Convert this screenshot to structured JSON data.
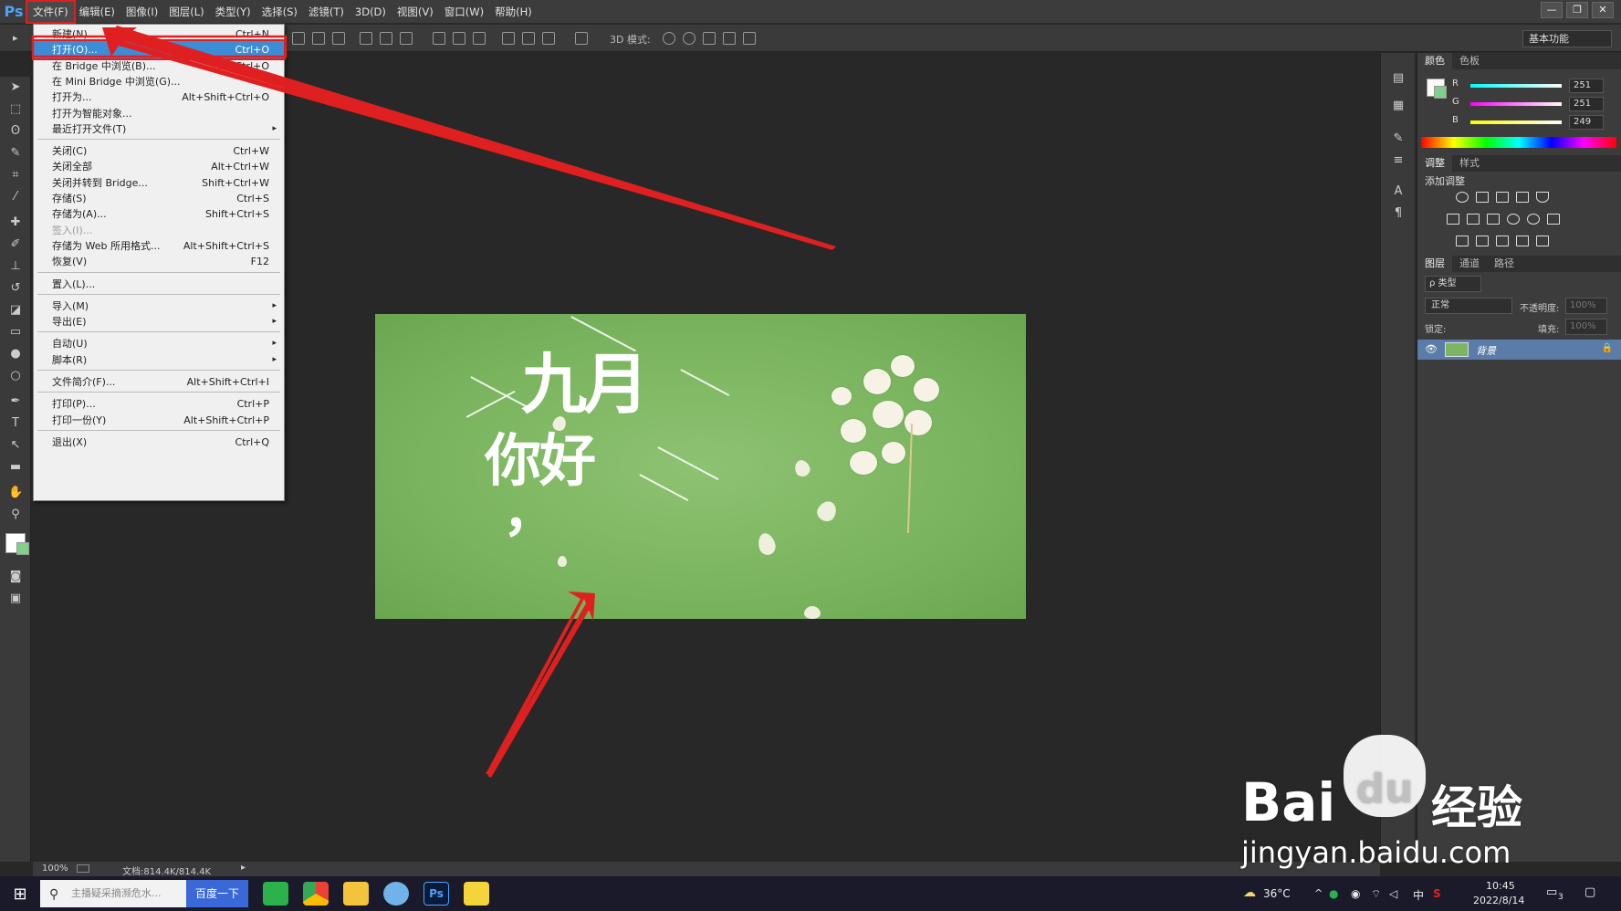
{
  "app": {
    "logo": "Ps"
  },
  "menubar": {
    "items": [
      "文件(F)",
      "编辑(E)",
      "图像(I)",
      "图层(L)",
      "类型(Y)",
      "选择(S)",
      "滤镜(T)",
      "3D(D)",
      "视图(V)",
      "窗口(W)",
      "帮助(H)"
    ]
  },
  "window_controls": {
    "minimize": "—",
    "restore": "❐",
    "close": "✕"
  },
  "optionsbar": {
    "mode3d_label": "3D 模式:",
    "workspace": "基本功能"
  },
  "file_menu": {
    "items": [
      {
        "label": "新建(N)...",
        "shortcut": "Ctrl+N"
      },
      {
        "label": "打开(O)...",
        "shortcut": "Ctrl+O",
        "highlighted": true
      },
      {
        "label": "在 Bridge 中浏览(B)...",
        "shortcut": "Alt+Ctrl+O"
      },
      {
        "label": "在 Mini Bridge 中浏览(G)...",
        "shortcut": ""
      },
      {
        "label": "打开为...",
        "shortcut": "Alt+Shift+Ctrl+O"
      },
      {
        "label": "打开为智能对象...",
        "shortcut": ""
      },
      {
        "label": "最近打开文件(T)",
        "shortcut": "",
        "submenu": true
      },
      {
        "label": "关闭(C)",
        "shortcut": "Ctrl+W"
      },
      {
        "label": "关闭全部",
        "shortcut": "Alt+Ctrl+W"
      },
      {
        "label": "关闭并转到 Bridge...",
        "shortcut": "Shift+Ctrl+W"
      },
      {
        "label": "存储(S)",
        "shortcut": "Ctrl+S"
      },
      {
        "label": "存储为(A)...",
        "shortcut": "Shift+Ctrl+S"
      },
      {
        "label": "签入(I)...",
        "shortcut": "",
        "disabled": true
      },
      {
        "label": "存储为 Web 所用格式...",
        "shortcut": "Alt+Shift+Ctrl+S"
      },
      {
        "label": "恢复(V)",
        "shortcut": "F12"
      },
      {
        "label": "置入(L)...",
        "shortcut": ""
      },
      {
        "label": "导入(M)",
        "shortcut": "",
        "submenu": true
      },
      {
        "label": "导出(E)",
        "shortcut": "",
        "submenu": true
      },
      {
        "label": "自动(U)",
        "shortcut": "",
        "submenu": true
      },
      {
        "label": "脚本(R)",
        "shortcut": "",
        "submenu": true
      },
      {
        "label": "文件简介(F)...",
        "shortcut": "Alt+Shift+Ctrl+I"
      },
      {
        "label": "打印(P)...",
        "shortcut": "Ctrl+P"
      },
      {
        "label": "打印一份(Y)",
        "shortcut": "Alt+Shift+Ctrl+P"
      },
      {
        "label": "退出(X)",
        "shortcut": "Ctrl+Q"
      }
    ],
    "submenu_arrow": "▸"
  },
  "document": {
    "title_line1": "九月",
    "title_line2": "你好",
    "punct": "，",
    "background_color": "#7cb563"
  },
  "statusbar": {
    "zoom": "100%",
    "doc_info": "文档:814.4K/814.4K",
    "arrow": "▸"
  },
  "color_panel": {
    "tabs": [
      "颜色",
      "色板"
    ],
    "channels": [
      {
        "name": "R",
        "value": "251"
      },
      {
        "name": "G",
        "value": "251"
      },
      {
        "name": "B",
        "value": "249"
      }
    ]
  },
  "adjust_panel": {
    "tabs": [
      "调整",
      "样式"
    ],
    "heading": "添加调整"
  },
  "layers_panel": {
    "tabs": [
      "图层",
      "通道",
      "路径"
    ],
    "kind_filter": "ρ 类型",
    "blend_mode": "正常",
    "opacity_label": "不透明度:",
    "opacity_value": "100%",
    "lock_label": "锁定:",
    "fill_label": "填充:",
    "fill_value": "100%",
    "layer_name": "背景"
  },
  "taskbar": {
    "search_placeholder": "主播疑采摘濒危水...",
    "search_button": "百度一下",
    "weather": "36°C",
    "ime": "中",
    "time": "10:45",
    "date": "2022/8/14",
    "notifications": "3"
  },
  "watermark": {
    "brand": "Bai",
    "brand2": "du",
    "cn": "经验",
    "url": "jingyan.baidu.com"
  },
  "colors": {
    "accent_red": "#e02020",
    "menu_highlight": "#3c8cd6",
    "ps_blue": "#4aa3ff"
  }
}
